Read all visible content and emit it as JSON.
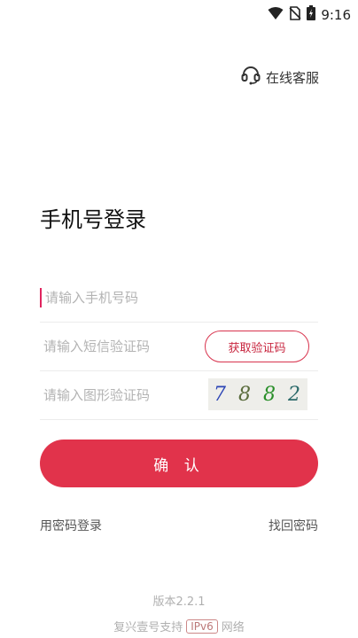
{
  "status_bar": {
    "time": "9:16"
  },
  "header": {
    "service_label": "在线客服"
  },
  "login": {
    "title": "手机号登录",
    "phone_placeholder": "请输入手机号码",
    "sms_placeholder": "请输入短信验证码",
    "get_code_label": "获取验证码",
    "captcha_placeholder": "请输入图形验证码",
    "captcha_text": [
      "7",
      "8",
      "8",
      "2"
    ],
    "submit_label": "确 认",
    "password_login": "用密码登录",
    "forgot_password": "找回密码"
  },
  "footer": {
    "version": "版本2.2.1",
    "support_prefix": "复兴壹号支持",
    "ipv6_badge": "IPv6",
    "support_suffix": "网络"
  },
  "colors": {
    "accent": "#e1334b",
    "captcha_digits": [
      "#2c45b5",
      "#5a6c3c",
      "#2a8f2a",
      "#2c6a6a"
    ]
  }
}
